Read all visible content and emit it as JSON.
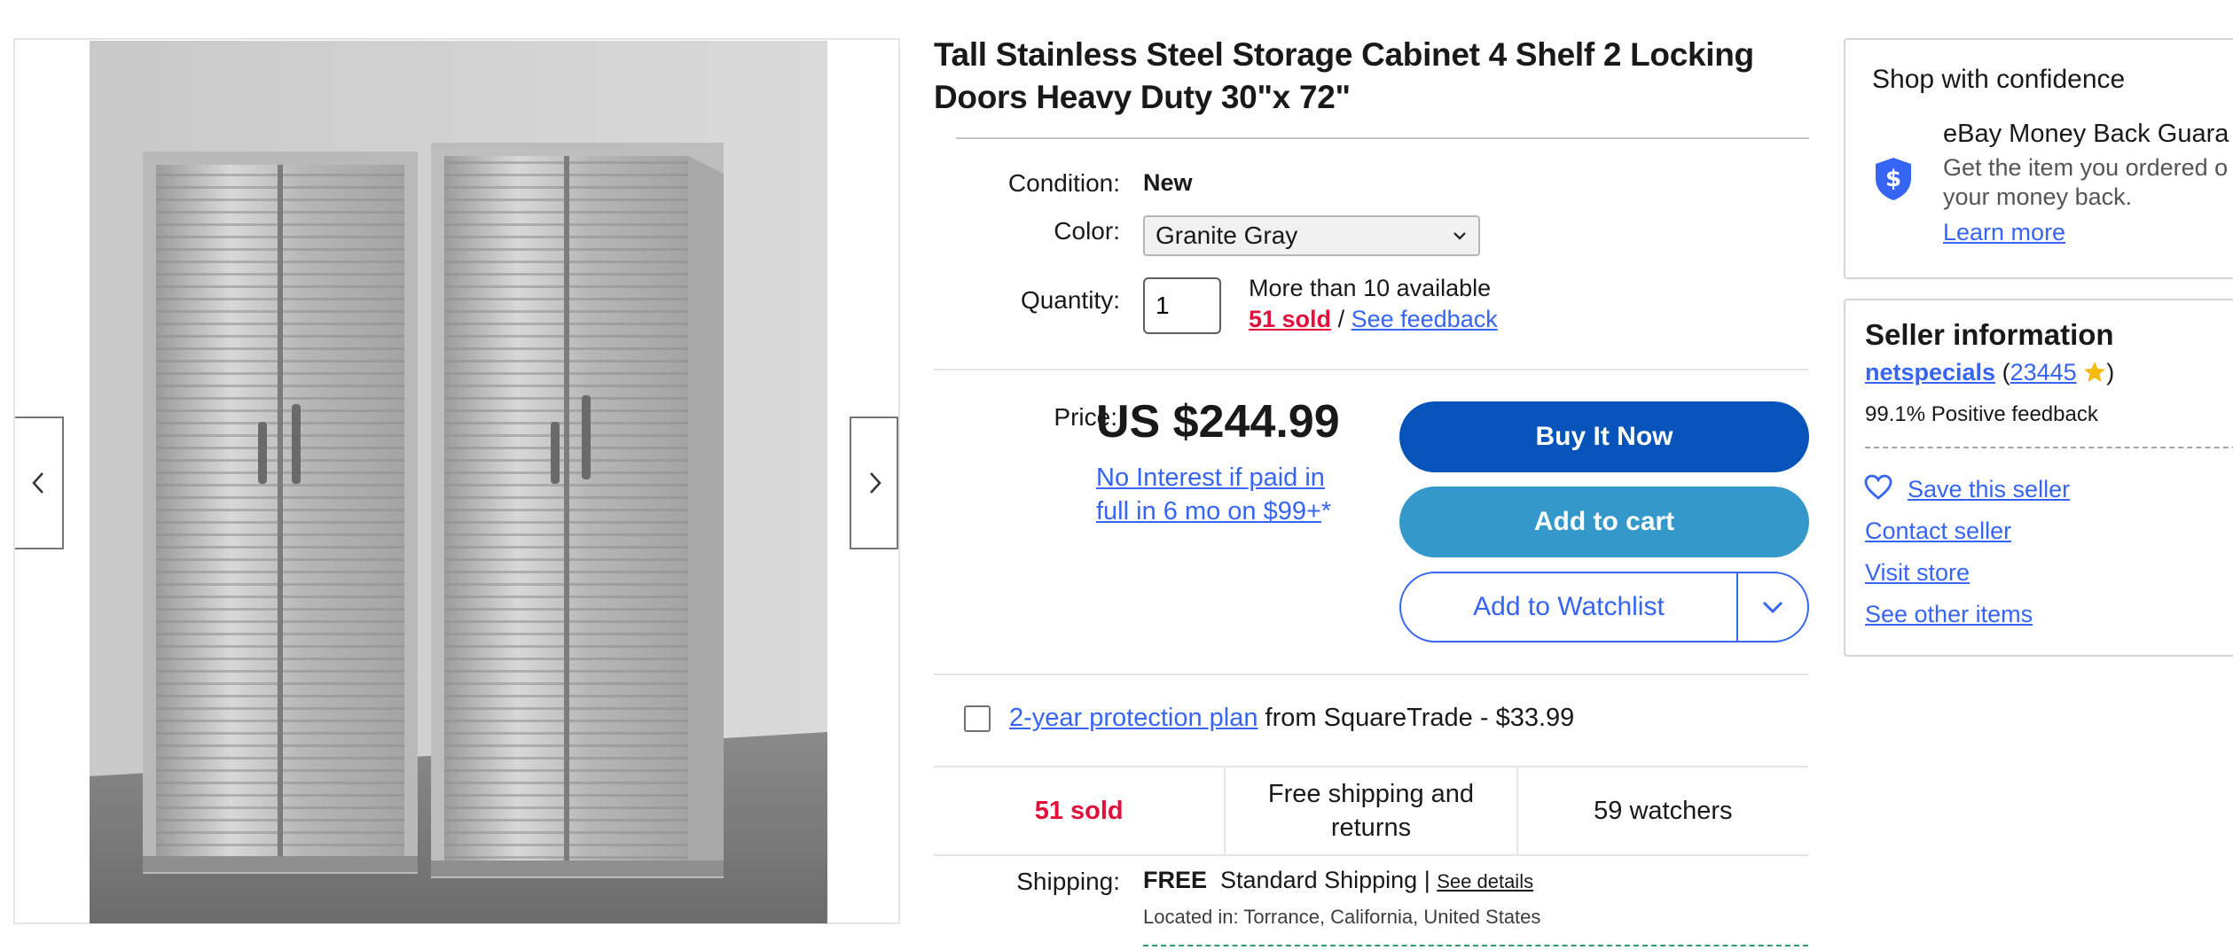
{
  "product": {
    "title_line1": "Tall Stainless Steel Storage Cabinet 4 Shelf 2 Locking",
    "title_line2": "Doors Heavy Duty 30\"x 72\""
  },
  "details": {
    "condition_label": "Condition:",
    "condition_value": "New",
    "color_label": "Color:",
    "color_selected": "Granite Gray",
    "quantity_label": "Quantity:",
    "quantity_value": "1",
    "availability": "More than 10 available",
    "sold_link": "51 sold",
    "separator": "/",
    "feedback_link": "See feedback"
  },
  "pricing": {
    "price_label": "Price:",
    "price": "US $244.99",
    "financing_line1": "No Interest if paid in",
    "financing_line2": "full in 6 mo on $99+",
    "financing_asterisk": "*"
  },
  "actions": {
    "buy_now": "Buy It Now",
    "add_to_cart": "Add to cart",
    "add_to_watchlist": "Add to Watchlist"
  },
  "protection": {
    "link": "2-year protection plan",
    "text": " from SquareTrade - $33.99"
  },
  "stats": {
    "sold": "51 sold",
    "shipping_line1": "Free shipping and",
    "shipping_line2": "returns",
    "watchers": "59 watchers"
  },
  "shipping": {
    "label": "Shipping:",
    "free": "FREE",
    "method": "Standard Shipping |",
    "details_link": "See details",
    "location": "Located in:  Torrance, California, United States"
  },
  "confidence": {
    "heading": "Shop with confidence",
    "guarantee_title": "eBay Money Back Guara",
    "guarantee_text1": "Get the item you ordered o",
    "guarantee_text2": "your money back.",
    "learn_more": "Learn more"
  },
  "seller": {
    "heading": "Seller information",
    "name": "netspecials",
    "open_paren": "(",
    "score": "23445",
    "close_paren": ")",
    "positive_feedback": "99.1% Positive feedback",
    "save_seller": "Save this seller",
    "contact": "Contact seller",
    "visit_store": "Visit store",
    "other_items": "See other items"
  },
  "colors": {
    "primary_blue": "#0654ba",
    "cart_blue": "#3498ca",
    "link_blue": "#3665f3",
    "sold_red": "#e0103a",
    "star_gold": "#f5b90f"
  },
  "icons": [
    "chevron-left-icon",
    "chevron-right-icon",
    "chevron-down-icon",
    "shield-dollar-icon",
    "heart-icon",
    "star-icon"
  ]
}
